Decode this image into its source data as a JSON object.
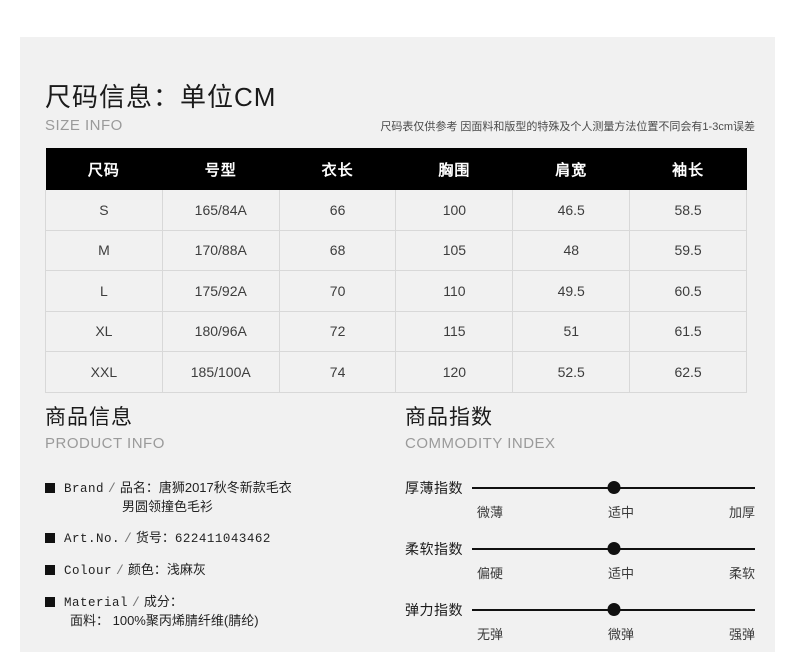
{
  "size_section": {
    "title_cn": "尺码信息：单位CM",
    "title_en": "SIZE INFO",
    "disclaimer": "尺码表仅供参考  因面料和版型的特殊及个人测量方法位置不同会有1-3cm误差",
    "table": {
      "headers": [
        "尺码",
        "号型",
        "衣长",
        "胸围",
        "肩宽",
        "袖长"
      ],
      "rows": [
        [
          "S",
          "165/84A",
          "66",
          "100",
          "46.5",
          "58.5"
        ],
        [
          "M",
          "170/88A",
          "68",
          "105",
          "48",
          "59.5"
        ],
        [
          "L",
          "175/92A",
          "70",
          "110",
          "49.5",
          "60.5"
        ],
        [
          "XL",
          "180/96A",
          "72",
          "115",
          "51",
          "61.5"
        ],
        [
          "XXL",
          "185/100A",
          "74",
          "120",
          "52.5",
          "62.5"
        ]
      ]
    }
  },
  "product_info": {
    "title_cn": "商品信息",
    "title_en": "PRODUCT INFO",
    "items": [
      {
        "label_en": "Brand",
        "label_cn": "品名：",
        "value": "唐狮2017秋冬新款毛衣",
        "value_line2": "男圆领撞色毛衫"
      },
      {
        "label_en": "Art.No.",
        "label_cn": "货号：",
        "value": "622411043462",
        "value_line2": ""
      },
      {
        "label_en": "Colour",
        "label_cn": "颜色：",
        "value": "浅麻灰",
        "value_line2": ""
      },
      {
        "label_en": "Material",
        "label_cn": "成分：",
        "value": "",
        "value_line2": "面料：  100%聚丙烯腈纤维(腈纶)"
      }
    ]
  },
  "commodity_index": {
    "title_cn": "商品指数",
    "title_en": "COMMODITY INDEX",
    "sliders": [
      {
        "label": "厚薄指数",
        "scale": [
          "微薄",
          "适中",
          "加厚"
        ],
        "position_pct": 50
      },
      {
        "label": "柔软指数",
        "scale": [
          "偏硬",
          "适中",
          "柔软"
        ],
        "position_pct": 50
      },
      {
        "label": "弹力指数",
        "scale": [
          "无弹",
          "微弹",
          "强弹"
        ],
        "position_pct": 50
      }
    ]
  },
  "colors": {
    "panel_bg": "#f1f1f1",
    "header_bg": "#000000",
    "accent": "#111111",
    "muted_text": "#9a9a9a"
  }
}
